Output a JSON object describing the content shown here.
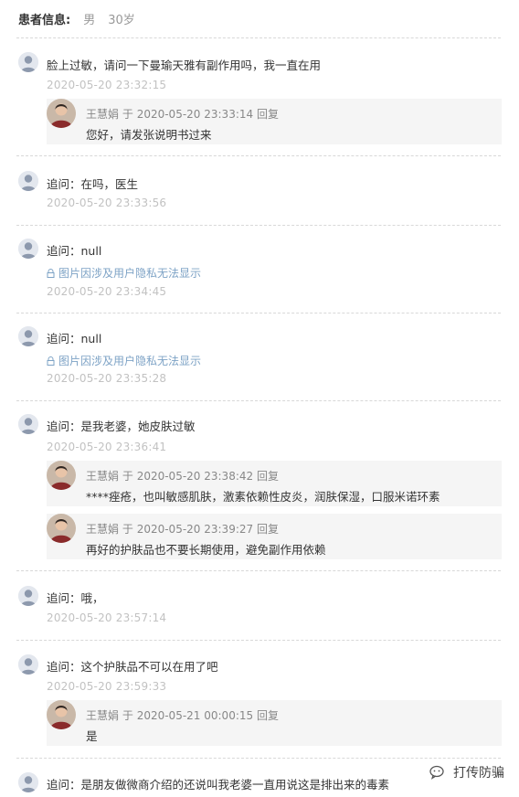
{
  "patient": {
    "label": "患者信息:",
    "gender": "男",
    "age": "30岁"
  },
  "doctor": {
    "name": "王慧娟"
  },
  "reply_word": "回复",
  "reply_prefix": "于",
  "image_hidden_note": "图片因涉及用户隐私无法显示",
  "entries": [
    {
      "question": "脸上过敏，请问一下曼瑜天雅有副作用吗，我一直在用",
      "time": "2020-05-20 23:32:15",
      "replies": [
        {
          "time": "2020-05-20 23:33:14",
          "text": "您好，请发张说明书过来"
        }
      ]
    },
    {
      "question": "追问：在吗，医生",
      "time": "2020-05-20 23:33:56"
    },
    {
      "question": "追问：null",
      "time": "2020-05-20 23:34:45"
    },
    {
      "question": "追问：null",
      "time": "2020-05-20 23:35:28"
    },
    {
      "question": "追问：是我老婆，她皮肤过敏",
      "time": "2020-05-20 23:36:41",
      "replies": [
        {
          "time": "2020-05-20 23:38:42",
          "text": "****痤疮，也叫敏感肌肤，激素依赖性皮炎，润肤保湿，口服米诺环素"
        },
        {
          "time": "2020-05-20 23:39:27",
          "text": "再好的护肤品也不要长期使用，避免副作用依赖"
        }
      ]
    },
    {
      "question": "追问：哦，",
      "time": "2020-05-20 23:57:14"
    },
    {
      "question": "追问：这个护肤品不可以在用了吧",
      "time": "2020-05-20 23:59:33",
      "replies": [
        {
          "time": "2020-05-21 00:00:15",
          "text": "是"
        }
      ]
    },
    {
      "question": "追问：是朋友做微商介绍的还说叫我老婆一直用说这是排出来的毒素"
    }
  ],
  "watermark": {
    "text": "打传防骗"
  }
}
